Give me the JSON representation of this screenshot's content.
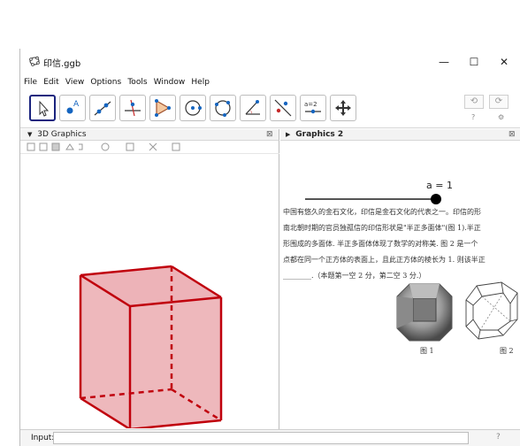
{
  "window": {
    "title": "印信.ggb",
    "minimize_label": "—",
    "maximize_label": "☐",
    "close_label": "✕"
  },
  "menu": [
    "File",
    "Edit",
    "View",
    "Options",
    "Tools",
    "Window",
    "Help"
  ],
  "toolbar": {
    "tools": [
      "move-tool",
      "point-tool",
      "line-tool",
      "perpendicular-line-tool",
      "polygon-tool",
      "circle-center-point-tool",
      "circle-three-points-tool",
      "angle-tool",
      "reflect-tool",
      "slider-tool",
      "move-graphics-view-tool"
    ],
    "slider_tool_text": "a=2",
    "undo_label": "⟲",
    "redo_label": "⟳",
    "help_label": "?",
    "settings_label": "⚙"
  },
  "left_panel": {
    "title": "3D Graphics"
  },
  "right_panel": {
    "title": "Graphics 2",
    "slider_text": "a = 1",
    "slider_value": 1,
    "doc_lines": [
      "中国有悠久的金石文化，印信是金石文化的代表之一。印信的形",
      "南北朝时期的官员独孤信的印信形状是\"半正多面体\"(图 1).半正",
      "形围成的多面体. 半正多面体体现了数学的对称美. 图 2 是一个",
      "点都在同一个正方体的表面上，且此正方体的棱长为 1. 则该半正",
      "________.（本题第一空 2 分，第二空 3 分.）"
    ],
    "fig1_label": "图 1",
    "fig2_label": "图 2"
  },
  "input_bar": {
    "label": "Input:",
    "value": "",
    "help_label": "?"
  },
  "colors": {
    "cube_edge": "#c0000c",
    "cube_fill": "#e8a0a6",
    "selected_tool_border": "#1a237e",
    "slider_point": "#000000"
  }
}
